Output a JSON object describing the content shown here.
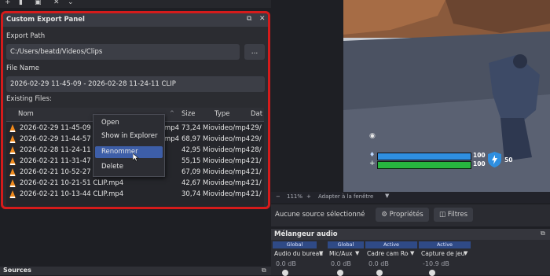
{
  "panel": {
    "title": "Custom Export Panel",
    "export_path_label": "Export Path",
    "export_path_value": "C:/Users/beatd/Videos/Clips",
    "browse_label": "...",
    "file_name_label": "File Name",
    "file_name_value": "2026-02-29 11-45-09 - 2026-02-28 11-24-11 CLIP",
    "existing_files_label": "Existing Files:",
    "columns": [
      "Nom",
      "Size",
      "Type",
      "Dat"
    ],
    "rows": [
      {
        "name": "2026-02-29 11-45-09 - 20",
        "ext": "mp4",
        "size": "73,24 Mio",
        "type": "video/mp4",
        "date": "29/"
      },
      {
        "name": "2026-02-29 11-44-57 - 20",
        "ext": "mp4",
        "size": "68,97 Mio",
        "type": "video/mp4",
        "date": "29/"
      },
      {
        "name": "2026-02-28 11-24-11 CLIP",
        "ext": "",
        "size": "42,95 Mio",
        "type": "video/mp4",
        "date": "28/"
      },
      {
        "name": "2026-02-21 11-31-47 CLIP",
        "ext": "",
        "size": "55,15 Mio",
        "type": "video/mp4",
        "date": "21/"
      },
      {
        "name": "2026-02-21 10-52-27 CLIP",
        "ext": "",
        "size": "67,09 Mio",
        "type": "video/mp4",
        "date": "21/"
      },
      {
        "name": "2026-02-21 10-21-51 CLIP.mp4",
        "ext": "",
        "size": "42,67 Mio",
        "type": "video/mp4",
        "date": "21/"
      },
      {
        "name": "2026-02-21 10-13-44 CLIP.mp4",
        "ext": "",
        "size": "30,74 Mio",
        "type": "video/mp4",
        "date": "21/"
      }
    ]
  },
  "context_menu": {
    "items": [
      "Open",
      "Show in Explorer",
      "Renommer",
      "Delete"
    ],
    "selected": "Renommer"
  },
  "hud": {
    "shield_value": "100",
    "health_value": "100",
    "extra_value": "50"
  },
  "status_bar": {
    "zoom": "111%",
    "fit": "Adapter à la fenêtre"
  },
  "source_bar": {
    "no_source": "Aucune source sélectionné",
    "properties": "Propriétés",
    "filters": "Filtres"
  },
  "mixer": {
    "title": "Mélangeur audio",
    "channels": [
      {
        "tag": "Global",
        "name": "Audio du bureau",
        "db": "0.0 dB"
      },
      {
        "tag": "Global",
        "name": "Mic/Aux",
        "db": "0.0 dB"
      },
      {
        "tag": "Active",
        "name": "Cadre cam Rodar",
        "db": "0.0 dB"
      },
      {
        "tag": "Active",
        "name": "Capture de jeu",
        "db": "-10.9 dB"
      }
    ]
  },
  "sources_panel": {
    "title": "Sources"
  },
  "colors": {
    "highlight_border": "#d51b1b",
    "selection": "#3d5ea8",
    "shield_bar": "#2f8fe0",
    "health_bar": "#27b53f"
  }
}
